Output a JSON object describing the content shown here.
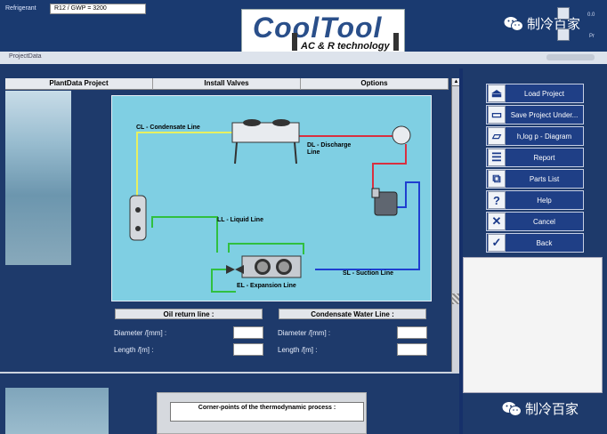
{
  "top": {
    "refrigerant_label": "Refrigerant",
    "refrigerant_value": "R12 / GWP = 3200",
    "logo_main": "CoolTool",
    "logo_sub": "AC & R technology",
    "right_text_1": "0.0",
    "right_text_2": "Pr",
    "watermark": "制冷百家"
  },
  "window": {
    "title": "ProjectData"
  },
  "tabs": [
    "PlantData Project",
    "Install Valves",
    "Options"
  ],
  "diagram": {
    "cl": "CL - Condensate Line",
    "dl": "DL - Discharge\nLine",
    "ll": "LL - Liquid Line",
    "el": "EL - Expansion Line",
    "sl": "SL - Suction Line"
  },
  "oil_panel": {
    "title": "Oil return line :",
    "diameter_label": "Diameter /[mm] :",
    "length_label": "Length /[m] :",
    "diameter_value": "",
    "length_value": ""
  },
  "condensate_panel": {
    "title": "Condensate Water Line :",
    "diameter_label": "Diameter /[mm] :",
    "length_label": "Length /[m] :",
    "diameter_value": "",
    "length_value": ""
  },
  "bottom_panel": {
    "title": "Corner-points of the thermodynamic process :"
  },
  "buttons": [
    {
      "label": "Load Project",
      "icon": "upload-icon"
    },
    {
      "label": "Save Project Under...",
      "icon": "save-icon"
    },
    {
      "label": "h,log p - Diagram",
      "icon": "folder-open-icon"
    },
    {
      "label": "Report",
      "icon": "report-icon"
    },
    {
      "label": "Parts List",
      "icon": "parts-list-icon"
    },
    {
      "label": "Help",
      "icon": "help-icon"
    },
    {
      "label": "Cancel",
      "icon": "close-icon"
    },
    {
      "label": "Back",
      "icon": "checkmark-icon"
    }
  ],
  "colors": {
    "background": "#1e3a6b",
    "diagram_bg": "#7fcfe3",
    "condensate_line": "#e8f060",
    "discharge_line": "#d83040",
    "liquid_line": "#30c040",
    "suction_line": "#1f3fd0"
  }
}
